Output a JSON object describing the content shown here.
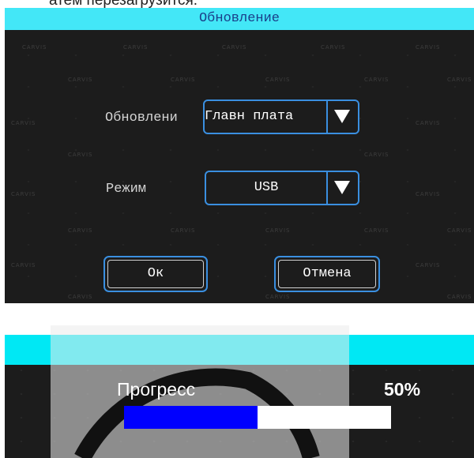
{
  "caption": "атем перезагрузится.",
  "update_dialog": {
    "title": "Обновление",
    "watermark": "CARVIS",
    "update_label": "Обновлени",
    "update_value": "Главн плата",
    "mode_label": "Режим",
    "mode_value": "USB",
    "ok_label": "Ок",
    "cancel_label": "Отмена"
  },
  "progress_dialog": {
    "label": "Прогресс",
    "percent_text": "50%",
    "progress": 0.5,
    "fill_color": "#0000ff",
    "header_color": "#00e8f4"
  },
  "colors": {
    "title_bar": "#43e7f7",
    "accent_border": "#3a8fe0",
    "dialog_bg": "#1c1c1c"
  }
}
